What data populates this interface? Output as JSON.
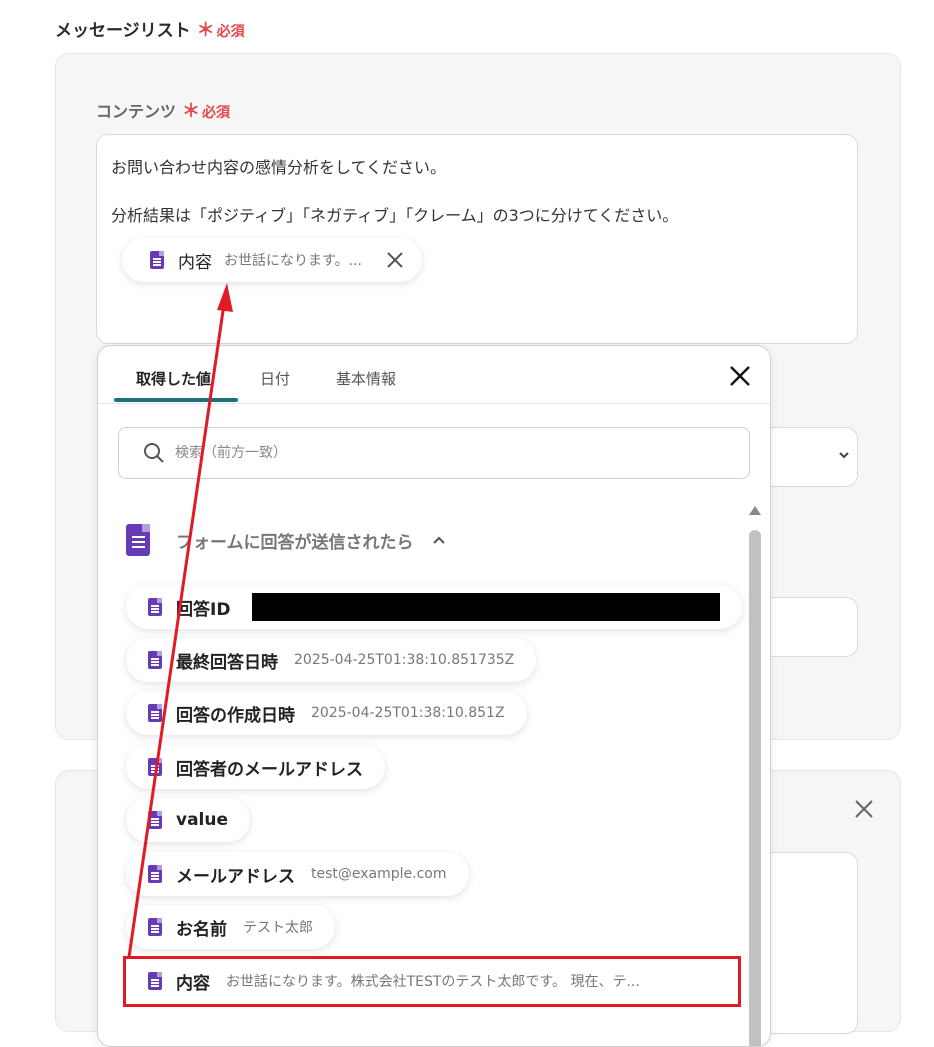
{
  "message_list": {
    "label": "メッセージリスト",
    "required_mark": "＊",
    "required_text": "必須"
  },
  "content": {
    "label": "コンテンツ",
    "required_mark": "＊",
    "required_text": "必須",
    "line1": "お問い合わせ内容の感情分析をしてください。",
    "line2": "分析結果は「ポジティブ」「ネガティブ」「クレーム」の3つに分けてください。",
    "chip": {
      "label": "内容",
      "value": "お世話になります。..."
    }
  },
  "popup": {
    "tabs": [
      {
        "label": "取得した値"
      },
      {
        "label": "日付"
      },
      {
        "label": "基本情報"
      }
    ],
    "search_placeholder": "検索（前方一致）",
    "group_title": "フォームに回答が送信されたら",
    "items": [
      {
        "label": "回答ID",
        "value": ""
      },
      {
        "label": "最終回答日時",
        "value": "2025-04-25T01:38:10.851735Z"
      },
      {
        "label": "回答の作成日時",
        "value": "2025-04-25T01:38:10.851Z"
      },
      {
        "label": "回答者のメールアドレス",
        "value": ""
      },
      {
        "label": "value",
        "value": ""
      },
      {
        "label": "メールアドレス",
        "value": "test@example.com"
      },
      {
        "label": "お名前",
        "value": "テスト太郎"
      },
      {
        "label": "内容",
        "value": "お世話になります。株式会社TESTのテスト太郎です。 現在、テ..."
      }
    ]
  },
  "colors": {
    "accent": "#1f6f7c",
    "form_icon": "#673ab7",
    "required": "#e5484d",
    "highlight": "#e01b24"
  }
}
